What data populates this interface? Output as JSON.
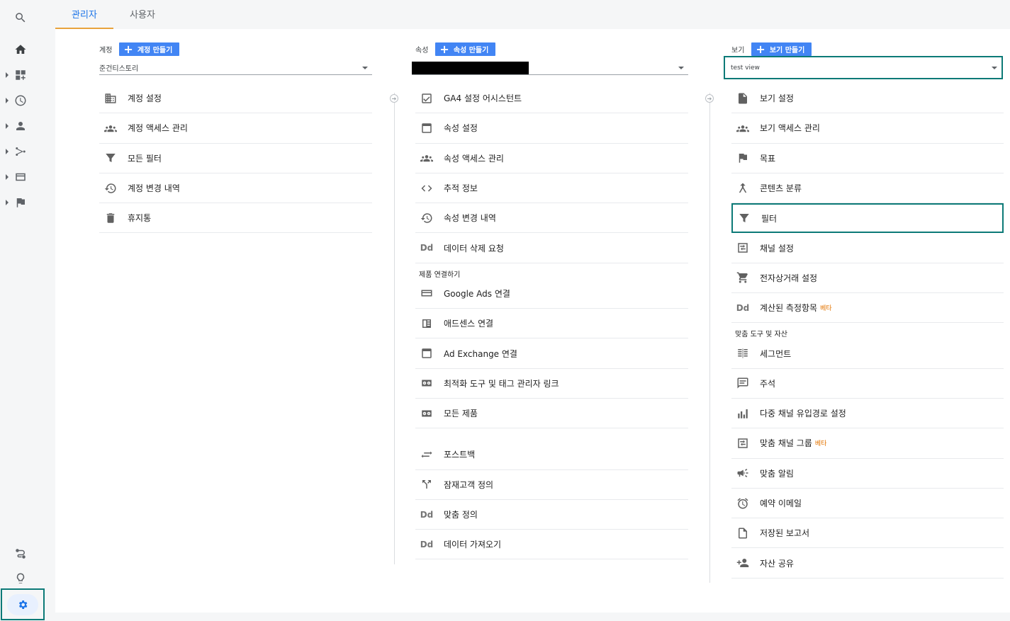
{
  "tabs": {
    "admin": "관리자",
    "user": "사용자"
  },
  "account": {
    "label": "계정",
    "create": "계정 만들기",
    "selected": "준건티스토리",
    "items": [
      {
        "label": "계정 설정",
        "icon": "building-icon"
      },
      {
        "label": "계정 액세스 관리",
        "icon": "people-icon"
      },
      {
        "label": "모든 필터",
        "icon": "filter-icon"
      },
      {
        "label": "계정 변경 내역",
        "icon": "history-icon"
      },
      {
        "label": "휴지통",
        "icon": "trash-icon"
      }
    ]
  },
  "property": {
    "label": "속성",
    "create": "속성 만들기",
    "items": [
      {
        "label": "GA4 설정 어시스턴트",
        "icon": "checkbox-icon"
      },
      {
        "label": "속성 설정",
        "icon": "window-icon"
      },
      {
        "label": "속성 액세스 관리",
        "icon": "people-icon"
      },
      {
        "label": "추적 정보",
        "icon": "code-icon"
      },
      {
        "label": "속성 변경 내역",
        "icon": "history-icon"
      },
      {
        "label": "데이터 삭제 요청",
        "icon": "dd-icon"
      }
    ],
    "section_label": "제품 연결하기",
    "link_items": [
      {
        "label": "Google Ads 연결",
        "icon": "ads-icon"
      },
      {
        "label": "애드센스 연결",
        "icon": "adsense-icon"
      },
      {
        "label": "Ad Exchange 연결",
        "icon": "window-icon"
      },
      {
        "label": "최적화 도구 및 태그 관리자 링크",
        "icon": "link-icon"
      },
      {
        "label": "모든 제품",
        "icon": "link-icon"
      }
    ],
    "extra_items": [
      {
        "label": "포스트백",
        "icon": "swap-icon"
      },
      {
        "label": "잠재고객 정의",
        "icon": "fork-icon"
      },
      {
        "label": "맞춤 정의",
        "icon": "dd-icon"
      },
      {
        "label": "데이터 가져오기",
        "icon": "dd-icon"
      }
    ],
    "dd_text": "Dd"
  },
  "view": {
    "label": "보기",
    "create": "보기 만들기",
    "selected": "test view",
    "items": [
      {
        "label": "보기 설정",
        "icon": "document-icon"
      },
      {
        "label": "보기 액세스 관리",
        "icon": "people-icon"
      },
      {
        "label": "목표",
        "icon": "flag-icon"
      },
      {
        "label": "콘텐츠 분류",
        "icon": "hierarchy-icon"
      },
      {
        "label": "필터",
        "icon": "filter-icon"
      },
      {
        "label": "채널 설정",
        "icon": "channel-icon"
      },
      {
        "label": "전자상거래 설정",
        "icon": "cart-icon"
      },
      {
        "label": "계산된 측정항목",
        "icon": "dd-icon",
        "badge": "베타"
      }
    ],
    "section_label": "맞춤 도구 및 자산",
    "tool_items": [
      {
        "label": "세그먼트",
        "icon": "segment-icon"
      },
      {
        "label": "주석",
        "icon": "comment-icon"
      },
      {
        "label": "다중 채널 유입경로 설정",
        "icon": "bar-chart-icon"
      },
      {
        "label": "맞춤 채널 그룹",
        "icon": "channel-icon",
        "badge": "베타"
      },
      {
        "label": "맞춤 알림",
        "icon": "megaphone-icon"
      },
      {
        "label": "예약 이메일",
        "icon": "alarm-icon"
      },
      {
        "label": "저장된 보고서",
        "icon": "document-outline-icon"
      },
      {
        "label": "자산 공유",
        "icon": "person-add-icon"
      }
    ]
  }
}
